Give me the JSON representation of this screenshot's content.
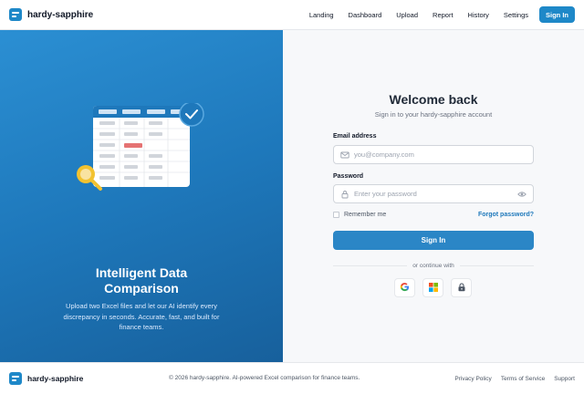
{
  "brand": {
    "name": "hardy-sapphire"
  },
  "nav": {
    "items": [
      {
        "label": "Landing"
      },
      {
        "label": "Dashboard"
      },
      {
        "label": "Upload"
      },
      {
        "label": "Report"
      },
      {
        "label": "History"
      },
      {
        "label": "Settings"
      }
    ],
    "signin_label": "Sign In"
  },
  "hero": {
    "title_line1": "Intelligent Data",
    "title_line2": "Comparison",
    "description": "Upload two Excel files and let our AI identify every discrepancy in seconds. Accurate, fast, and built for finance teams."
  },
  "form": {
    "title": "Welcome back",
    "subtitle": "Sign in to your hardy-sapphire account",
    "email_label": "Email address",
    "email_placeholder": "you@company.com",
    "password_label": "Password",
    "password_placeholder": "Enter your password",
    "remember_label": "Remember me",
    "forgot_label": "Forgot password?",
    "submit_label": "Sign In",
    "divider_text": "or continue with"
  },
  "socials": {
    "icons": [
      "google-icon",
      "microsoft-icon",
      "lock-icon"
    ]
  },
  "footer": {
    "brand": "hardy-sapphire",
    "copyright": "© 2026 hardy-sapphire. AI-powered Excel comparison for finance teams.",
    "links": [
      {
        "label": "Privacy Policy"
      },
      {
        "label": "Terms of Service"
      },
      {
        "label": "Support"
      }
    ]
  },
  "colors": {
    "accent": "#1e88c8",
    "panel_gradient_start": "#2b8fd3",
    "panel_gradient_end": "#17609c",
    "highlight_cell": "#e57373",
    "magnifier": "#f2c230"
  }
}
